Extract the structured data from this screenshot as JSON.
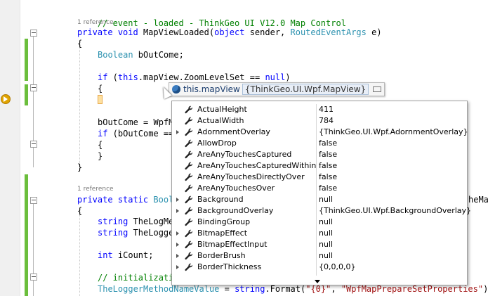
{
  "code": {
    "comment_event": "// event - loaded - ThinkGeo UI V12.0 Map Control",
    "ref1": "1 reference",
    "line_private": "private",
    "line_void": "void",
    "line_method": "MapViewLoaded(",
    "line_object": "object",
    "line_sender": " sender, ",
    "line_args_type": "RoutedEventArgs",
    "line_args": " e)",
    "brace_open": "{",
    "boolean_type": "Boolean",
    "boolean_var": " bOutCome;",
    "if_kw": "if",
    "if_rest1": " (",
    "if_this": "this",
    "if_rest2": ".mapView.ZoomLevelSet == ",
    "if_null": "null",
    "if_rest3": ")",
    "brace_open2": "{",
    "boutcome_assign": "bOutCome = WpfM",
    "if2_kw": "if",
    "if2_rest": " (bOutCome ==",
    "brace_open3": "{",
    "brace_close3": "}",
    "brace_close1": "}",
    "ref2": "1 reference",
    "private2": "private",
    "static2": "static",
    "bool2": "Bool",
    "the_map_tail": "heMap",
    "brace_open4": "{",
    "string1": "string",
    "string1_rest": " TheLogMe",
    "string2": "string",
    "string2_rest": " TheLogge",
    "int_kw": "int",
    "int_rest": " iCount;",
    "comment_init": "// initializati",
    "last_line_var": "TheLoggerMethodNameValue",
    "last_line_eq": " = ",
    "last_line_string": "string",
    "last_line_format": ".Format(",
    "last_line_arg1": "\"{0}\"",
    "last_line_comma": ", ",
    "last_line_arg2": "\"WpfMapPrepareSetProperties\"",
    "last_line_end": ");"
  },
  "datatip": {
    "expression": "this.mapView",
    "value": "{ThinkGeo.UI.Wpf.MapView}",
    "icon": "object-icon",
    "pin_icon": "pin-icon"
  },
  "members": [
    {
      "name": "ActualHeight",
      "value": "411",
      "expandable": false
    },
    {
      "name": "ActualWidth",
      "value": "784",
      "expandable": false
    },
    {
      "name": "AdornmentOverlay",
      "value": "{ThinkGeo.UI.Wpf.AdornmentOverlay}",
      "expandable": true
    },
    {
      "name": "AllowDrop",
      "value": "false",
      "expandable": false
    },
    {
      "name": "AreAnyTouchesCaptured",
      "value": "false",
      "expandable": false
    },
    {
      "name": "AreAnyTouchesCapturedWithin",
      "value": "false",
      "expandable": false
    },
    {
      "name": "AreAnyTouchesDirectlyOver",
      "value": "false",
      "expandable": false
    },
    {
      "name": "AreAnyTouchesOver",
      "value": "false",
      "expandable": false
    },
    {
      "name": "Background",
      "value": "null",
      "expandable": true
    },
    {
      "name": "BackgroundOverlay",
      "value": "{ThinkGeo.UI.Wpf.BackgroundOverlay}",
      "expandable": true
    },
    {
      "name": "BindingGroup",
      "value": "null",
      "expandable": false
    },
    {
      "name": "BitmapEffect",
      "value": "null",
      "expandable": true
    },
    {
      "name": "BitmapEffectInput",
      "value": "null",
      "expandable": true
    },
    {
      "name": "BorderBrush",
      "value": "null",
      "expandable": true
    },
    {
      "name": "BorderThickness",
      "value": "{0,0,0,0}",
      "expandable": true
    }
  ],
  "colors": {
    "keyword": "#0000ff",
    "type": "#2b91af",
    "comment": "#008000",
    "string": "#a31515",
    "change_bar": "#6bbe3c"
  }
}
